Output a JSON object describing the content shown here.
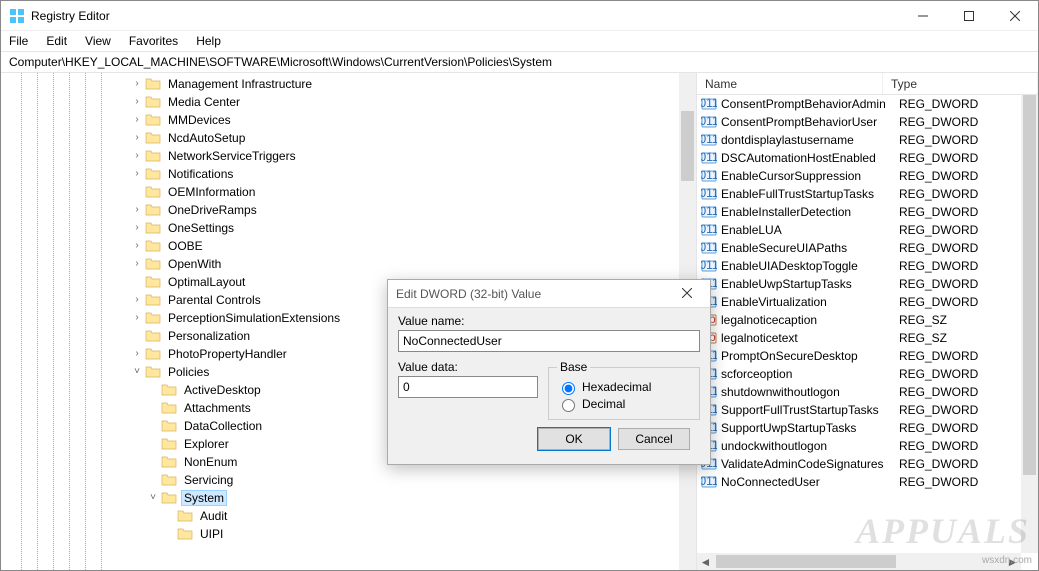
{
  "app": {
    "title": "Registry Editor"
  },
  "win_controls": {
    "min": "min",
    "max": "max",
    "close": "close"
  },
  "menubar": [
    "File",
    "Edit",
    "View",
    "Favorites",
    "Help"
  ],
  "addressbar": "Computer\\HKEY_LOCAL_MACHINE\\SOFTWARE\\Microsoft\\Windows\\CurrentVersion\\Policies\\System",
  "tree": {
    "items": [
      {
        "label": "Management Infrastructure",
        "expander": ">",
        "depth": 8
      },
      {
        "label": "Media Center",
        "expander": ">",
        "depth": 8
      },
      {
        "label": "MMDevices",
        "expander": ">",
        "depth": 8
      },
      {
        "label": "NcdAutoSetup",
        "expander": ">",
        "depth": 8
      },
      {
        "label": "NetworkServiceTriggers",
        "expander": ">",
        "depth": 8
      },
      {
        "label": "Notifications",
        "expander": ">",
        "depth": 8
      },
      {
        "label": "OEMInformation",
        "expander": "",
        "depth": 8
      },
      {
        "label": "OneDriveRamps",
        "expander": ">",
        "depth": 8
      },
      {
        "label": "OneSettings",
        "expander": ">",
        "depth": 8
      },
      {
        "label": "OOBE",
        "expander": ">",
        "depth": 8
      },
      {
        "label": "OpenWith",
        "expander": ">",
        "depth": 8
      },
      {
        "label": "OptimalLayout",
        "expander": "",
        "depth": 8
      },
      {
        "label": "Parental Controls",
        "expander": ">",
        "depth": 8
      },
      {
        "label": "PerceptionSimulationExtensions",
        "expander": ">",
        "depth": 8
      },
      {
        "label": "Personalization",
        "expander": "",
        "depth": 8
      },
      {
        "label": "PhotoPropertyHandler",
        "expander": ">",
        "depth": 8
      },
      {
        "label": "Policies",
        "expander": "v",
        "depth": 8
      },
      {
        "label": "ActiveDesktop",
        "expander": "",
        "depth": 9
      },
      {
        "label": "Attachments",
        "expander": "",
        "depth": 9
      },
      {
        "label": "DataCollection",
        "expander": "",
        "depth": 9
      },
      {
        "label": "Explorer",
        "expander": "",
        "depth": 9
      },
      {
        "label": "NonEnum",
        "expander": "",
        "depth": 9
      },
      {
        "label": "Servicing",
        "expander": "",
        "depth": 9
      },
      {
        "label": "System",
        "expander": "v",
        "depth": 9,
        "selected": true
      },
      {
        "label": "Audit",
        "expander": "",
        "depth": 10
      },
      {
        "label": "UIPI",
        "expander": "",
        "depth": 10
      }
    ]
  },
  "list": {
    "columns": {
      "name": "Name",
      "type": "Type"
    },
    "rows": [
      {
        "name": "ConsentPromptBehaviorAdmin",
        "type": "REG_DWORD",
        "icon": "dword"
      },
      {
        "name": "ConsentPromptBehaviorUser",
        "type": "REG_DWORD",
        "icon": "dword"
      },
      {
        "name": "dontdisplaylastusername",
        "type": "REG_DWORD",
        "icon": "dword"
      },
      {
        "name": "DSCAutomationHostEnabled",
        "type": "REG_DWORD",
        "icon": "dword"
      },
      {
        "name": "EnableCursorSuppression",
        "type": "REG_DWORD",
        "icon": "dword"
      },
      {
        "name": "EnableFullTrustStartupTasks",
        "type": "REG_DWORD",
        "icon": "dword"
      },
      {
        "name": "EnableInstallerDetection",
        "type": "REG_DWORD",
        "icon": "dword"
      },
      {
        "name": "EnableLUA",
        "type": "REG_DWORD",
        "icon": "dword"
      },
      {
        "name": "EnableSecureUIAPaths",
        "type": "REG_DWORD",
        "icon": "dword"
      },
      {
        "name": "EnableUIADesktopToggle",
        "type": "REG_DWORD",
        "icon": "dword"
      },
      {
        "name": "EnableUwpStartupTasks",
        "type": "REG_DWORD",
        "icon": "dword"
      },
      {
        "name": "EnableVirtualization",
        "type": "REG_DWORD",
        "icon": "dword"
      },
      {
        "name": "legalnoticecaption",
        "type": "REG_SZ",
        "icon": "sz"
      },
      {
        "name": "legalnoticetext",
        "type": "REG_SZ",
        "icon": "sz"
      },
      {
        "name": "PromptOnSecureDesktop",
        "type": "REG_DWORD",
        "icon": "dword"
      },
      {
        "name": "scforceoption",
        "type": "REG_DWORD",
        "icon": "dword"
      },
      {
        "name": "shutdownwithoutlogon",
        "type": "REG_DWORD",
        "icon": "dword"
      },
      {
        "name": "SupportFullTrustStartupTasks",
        "type": "REG_DWORD",
        "icon": "dword"
      },
      {
        "name": "SupportUwpStartupTasks",
        "type": "REG_DWORD",
        "icon": "dword"
      },
      {
        "name": "undockwithoutlogon",
        "type": "REG_DWORD",
        "icon": "dword"
      },
      {
        "name": "ValidateAdminCodeSignatures",
        "type": "REG_DWORD",
        "icon": "dword"
      },
      {
        "name": "NoConnectedUser",
        "type": "REG_DWORD",
        "icon": "dword"
      }
    ]
  },
  "dialog": {
    "title": "Edit DWORD (32-bit) Value",
    "value_name_label": "Value name:",
    "value_name": "NoConnectedUser",
    "value_data_label": "Value data:",
    "value_data": "0",
    "base_label": "Base",
    "hex_label": "Hexadecimal",
    "dec_label": "Decimal",
    "ok": "OK",
    "cancel": "Cancel"
  },
  "watermark": "APPUALS",
  "wsxdn": "wsxdn.com"
}
